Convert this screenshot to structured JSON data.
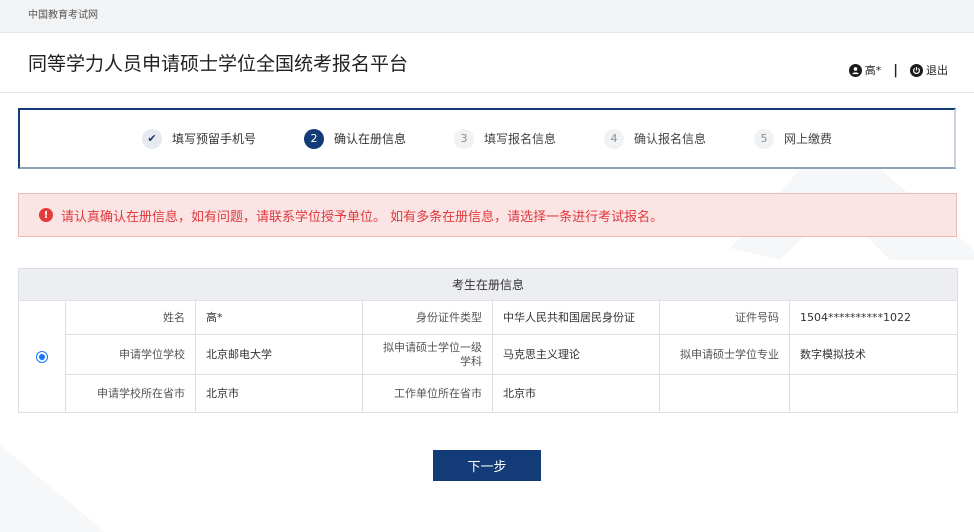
{
  "topbar": {
    "site_link": "中国教育考试网"
  },
  "header": {
    "title": "同等学力人员申请硕士学位全国统考报名平台",
    "user_name": "高*",
    "separator": "|",
    "logout_label": "退出"
  },
  "steps": [
    {
      "num": "✔",
      "label": "填写预留手机号",
      "state": "done"
    },
    {
      "num": "2",
      "label": "确认在册信息",
      "state": "active"
    },
    {
      "num": "3",
      "label": "填写报名信息",
      "state": "todo"
    },
    {
      "num": "4",
      "label": "确认报名信息",
      "state": "todo"
    },
    {
      "num": "5",
      "label": "网上缴费",
      "state": "todo"
    }
  ],
  "alert": {
    "icon": "!",
    "message": "请认真确认在册信息，如有问题，请联系学位授予单位。 如有多条在册信息，请选择一条进行考试报名。"
  },
  "table": {
    "title": "考生在册信息",
    "rows": [
      [
        {
          "label": "姓名",
          "value": "高*"
        },
        {
          "label": "身份证件类型",
          "value": "中华人民共和国居民身份证"
        },
        {
          "label": "证件号码",
          "value": "1504**********1022"
        }
      ],
      [
        {
          "label": "申请学位学校",
          "value": "北京邮电大学"
        },
        {
          "label": "拟申请硕士学位一级学科",
          "value": "马克思主义理论"
        },
        {
          "label": "拟申请硕士学位专业",
          "value": "数字模拟技术"
        }
      ],
      [
        {
          "label": "申请学校所在省市",
          "value": "北京市"
        },
        {
          "label": "工作单位所在省市",
          "value": "北京市"
        },
        {
          "label": "",
          "value": ""
        }
      ]
    ],
    "selected": true
  },
  "next_button": {
    "label": "下一步"
  },
  "colors": {
    "primary": "#123b78",
    "alert_text": "#e0393e",
    "alert_bg": "#fbe4e4",
    "radio": "#1677ff"
  },
  "icons": {
    "user": "user-circle-icon",
    "logout": "power-icon",
    "alert": "exclamation-circle-icon",
    "step_done": "check-icon"
  }
}
